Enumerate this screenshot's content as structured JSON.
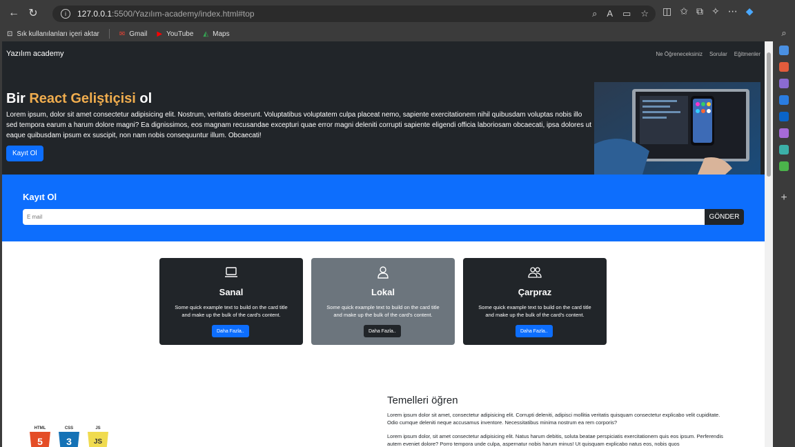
{
  "browser": {
    "url_host": "127.0.0.1",
    "url_path": ":5500/Yazılım-academy/index.html#top",
    "bookmarks": [
      {
        "label": "Sık kullanılanları içeri aktar",
        "icon": "import-icon"
      },
      {
        "label": "Gmail",
        "icon": "gmail-icon"
      },
      {
        "label": "YouTube",
        "icon": "youtube-icon"
      },
      {
        "label": "Maps",
        "icon": "maps-icon"
      }
    ]
  },
  "nav": {
    "brand": "Yazılım academy",
    "links": [
      "Ne Öğreneceksiniz",
      "Sorular",
      "Eğitmenler"
    ]
  },
  "hero": {
    "title_prefix": "Bir ",
    "title_highlight": "React Geliştiçisi",
    "title_suffix": " ol",
    "text": "Lorem ipsum, dolor sit amet consectetur adipisicing elit. Nostrum, veritatis deserunt. Voluptatibus voluptatem culpa placeat nemo, sapiente exercitationem nihil quibusdam voluptas nobis illo sed tempora earum a harum dolore magni? Ea dignissimos, eos magnam recusandae excepturi quae error magni deleniti corrupti sapiente eligendi officia laboriosam obcaecati, ipsa dolores ut eaque quibusdam ipsum ex suscipit, non nam nobis consequuntur illum. Obcaecati!",
    "button": "Kayıt Ol"
  },
  "signup": {
    "title": "Kayıt Ol",
    "placeholder": "E mail",
    "button": "GÖNDER"
  },
  "cards": [
    {
      "title": "Sanal",
      "icon": "laptop-icon",
      "text": "Some quick example text to build on the card title and make up the bulk of the card's content.",
      "button": "Daha Fazla.."
    },
    {
      "title": "Lokal",
      "icon": "person-icon",
      "text": "Some quick example text to build on the card title and make up the bulk of the card's content.",
      "button": "Daha Fazla.."
    },
    {
      "title": "Çarpraz",
      "icon": "people-icon",
      "text": "Some quick example text to build on the card title and make up the bulk of the card's content.",
      "button": "Daha Fazla.."
    }
  ],
  "basics": {
    "title": "Temelleri öğren",
    "p1": "Lorem ipsum dolor sit amet, consectetur adipisicing elit. Corrupti deleniti, adipisci mollitia veritatis quisquam consectetur explicabo velit cupiditate. Odio cumque deleniti neque accusamus inventore. Necessitatibus minima nostrum ea rem corporis?",
    "p2": "Lorem ipsum dolor, sit amet consectetur adipisicing elit. Natus harum debitis, soluta beatae perspiciatis exercitationem quis eos ipsum. Perferendis autem eveniet dolore? Porro tempora unde culpa, aspernatur nobis harum minus! Ut quisquam explicabo natus eos, nobis quos"
  },
  "logos": [
    {
      "label": "HTML",
      "glyph": "5",
      "color": "#e44d26"
    },
    {
      "label": "CSS",
      "glyph": "3",
      "color": "#1572b6"
    },
    {
      "label": "JS",
      "glyph": "JS",
      "color": "#f0db4f"
    }
  ]
}
